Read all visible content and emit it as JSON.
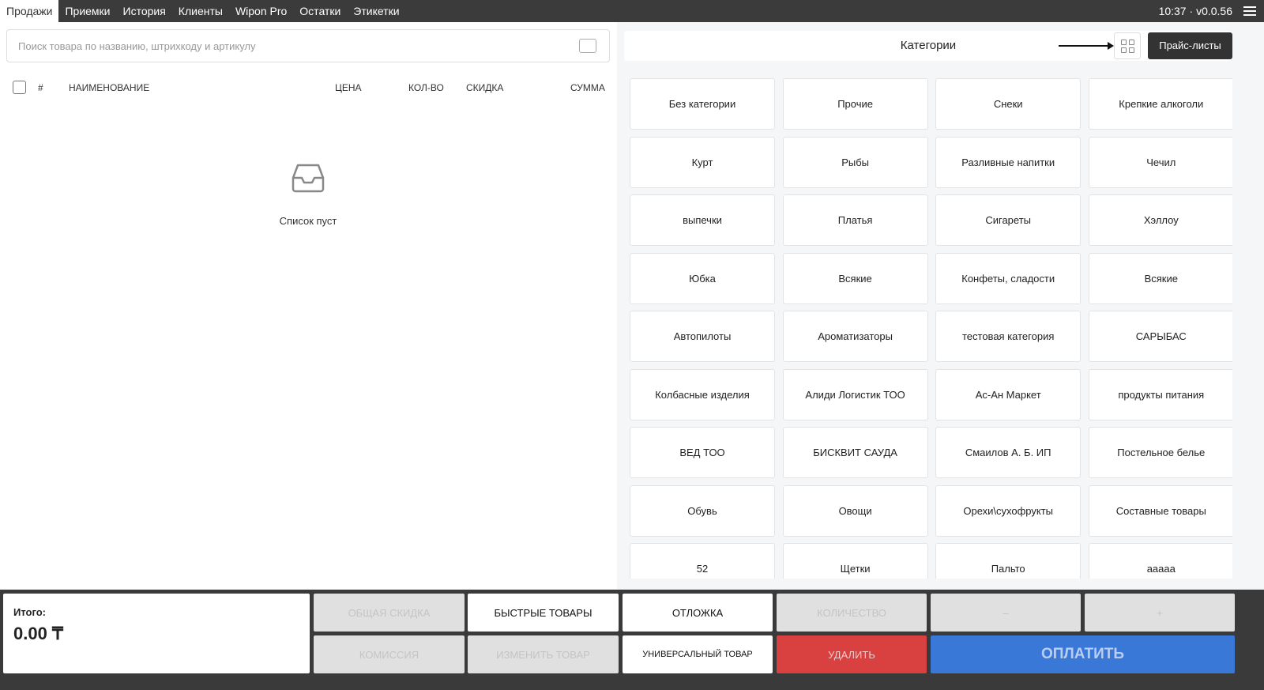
{
  "nav": {
    "tabs": [
      "Продажи",
      "Приемки",
      "История",
      "Клиенты",
      "Wipon Pro",
      "Остатки",
      "Этикетки"
    ],
    "time": "10:37",
    "version": "v0.0.56"
  },
  "search": {
    "placeholder": "Поиск товара по названию, штрихкоду и артикулу"
  },
  "table": {
    "columns": {
      "num": "#",
      "name": "НАИМЕНОВАНИЕ",
      "price": "ЦЕНА",
      "qty": "КОЛ-ВО",
      "discount": "СКИДКА",
      "sum": "СУММА"
    },
    "empty_text": "Список пуст"
  },
  "categories": {
    "title": "Категории",
    "price_lists": "Прайс-листы",
    "items": [
      "Без категории",
      "Прочие",
      "Снеки",
      "Крепкие алкоголи",
      "Курт",
      "Рыбы",
      "Разливные напитки",
      "Чечил",
      "выпечки",
      "Платья",
      "Сигареты",
      "Хэллоу",
      "Юбка",
      "Всякие",
      "Конфеты, сладости",
      "Всякие",
      "Автопилоты",
      "Ароматизаторы",
      "тестовая категория",
      "САРЫБАС",
      "Колбасные изделия",
      "Алиди Логистик ТОО",
      "Ас-Ан Маркет",
      "продукты питания",
      "ВЕД ТОО",
      "БИСКВИТ САУДА",
      "Смаилов А. Б. ИП",
      "Постельное белье",
      "Обувь",
      "Овощи",
      "Орехи\\сухофрукты",
      "Составные товары",
      "52",
      "Щетки",
      "Пальто",
      "ааааа"
    ]
  },
  "footer": {
    "total_label": "Итого:",
    "total_value": "0.00",
    "currency": "₸",
    "general_discount": "ОБЩАЯ СКИДКА",
    "quick_items": "БЫСТРЫЕ ТОВАРЫ",
    "hold": "ОТЛОЖКА",
    "quantity": "КОЛИЧЕСТВО",
    "minus": "–",
    "plus": "+",
    "commission": "КОМИССИЯ",
    "edit_item": "ИЗМЕНИТЬ ТОВАР",
    "universal_item": "УНИВЕРСАЛЬНЫЙ ТОВАР",
    "delete": "УДАЛИТЬ",
    "pay": "ОПЛАТИТЬ"
  },
  "colors": {
    "delete": "#d94040",
    "pay": "#3a78d8",
    "topbar": "#3b3b3b"
  }
}
